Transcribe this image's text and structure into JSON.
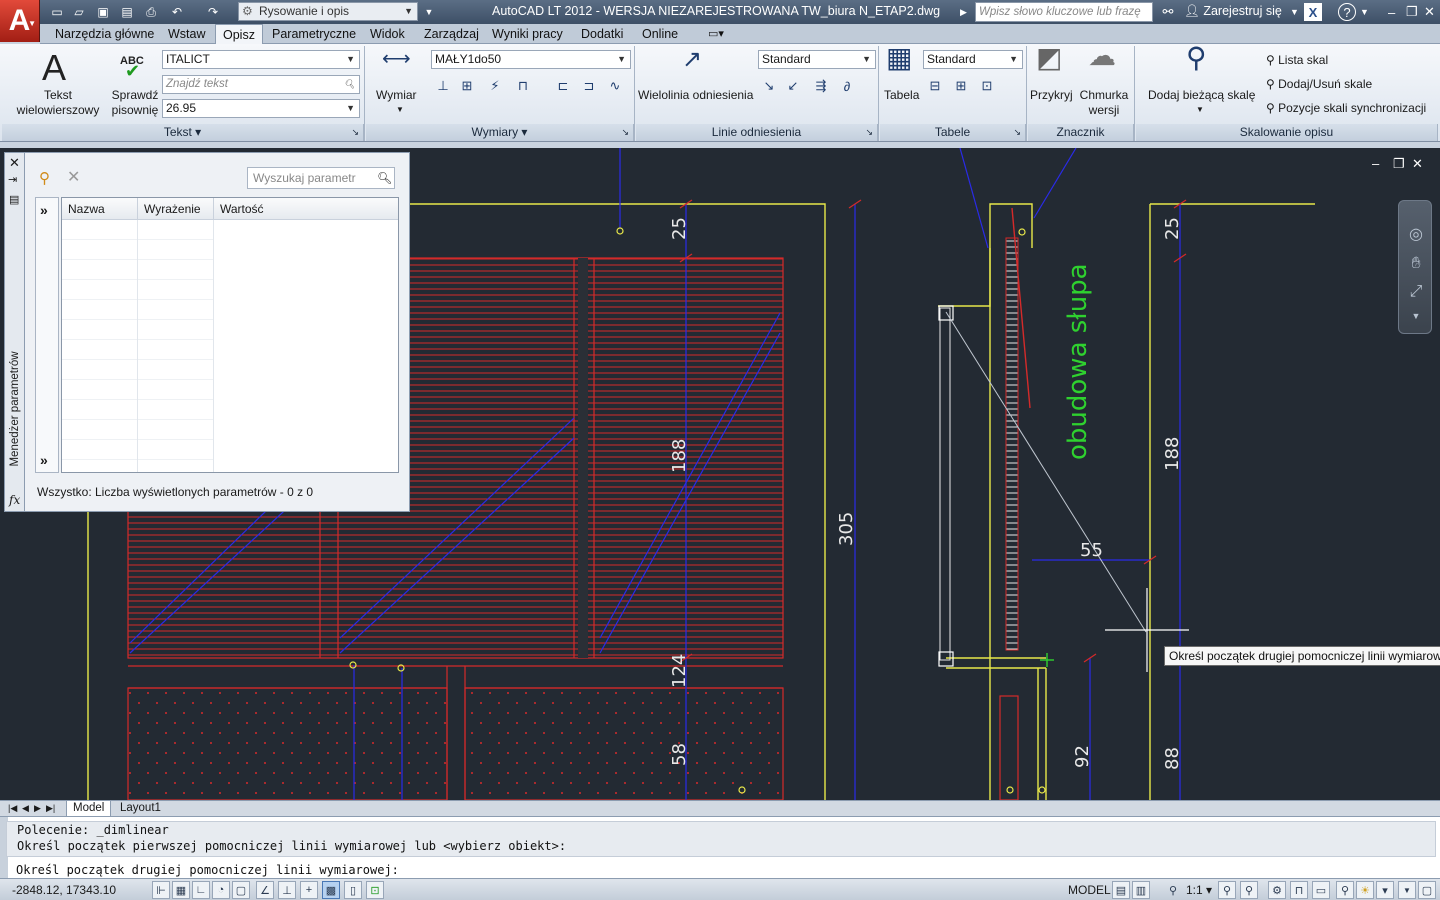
{
  "window": {
    "title": "AutoCAD LT 2012 - WERSJA NIEZAREJESTROWANA    TW_biura N_ETAP2.dwg",
    "workspace": "Rysowanie i opis",
    "search_placeholder": "Wpisz słowo kluczowe lub frazę",
    "sign_in": "Zarejestruj się"
  },
  "ribbon_tabs": [
    {
      "label": "Narzędzia główne"
    },
    {
      "label": "Wstaw"
    },
    {
      "label": "Opisz"
    },
    {
      "label": "Parametryczne"
    },
    {
      "label": "Widok"
    },
    {
      "label": "Zarządzaj"
    },
    {
      "label": "Wyniki pracy"
    },
    {
      "label": "Dodatki"
    },
    {
      "label": "Online"
    }
  ],
  "ribbon": {
    "tekst": {
      "panel_label": "Tekst",
      "multiline_line1": "Tekst",
      "multiline_line2": "wielowierszowy",
      "spell_line1": "Sprawdź",
      "spell_line2": "pisownię",
      "spell_abc": "ABC",
      "style": "ITALICT",
      "find_placeholder": "Znajdź tekst",
      "height": "26.95"
    },
    "wymiary": {
      "panel_label": "Wymiary",
      "dimension": "Wymiar",
      "style": "MAŁY1do50"
    },
    "linie": {
      "panel_label": "Linie odniesienia",
      "multileader": "Wielolinia odniesienia",
      "style": "Standard"
    },
    "tabele": {
      "panel_label": "Tabele",
      "table": "Tabela",
      "style": "Standard"
    },
    "znacznik": {
      "panel_label": "Znacznik",
      "wipeout": "Przykryj",
      "revcloud_line1": "Chmurka",
      "revcloud_line2": "wersji"
    },
    "skalowanie": {
      "panel_label": "Skalowanie opisu",
      "add_current_scale": "Dodaj bieżącą skalę",
      "scale_list": "Lista skal",
      "add_remove_scales": "Dodaj/Usuń skale",
      "sync_scale_positions": "Pozycje skali synchronizacji"
    }
  },
  "param_manager": {
    "side_title": "Menedżer parametrów",
    "search_placeholder": "Wyszukaj parametr",
    "columns": [
      "Nazwa",
      "Wyrażenie",
      "Wartość"
    ],
    "status": "Wszystko: Liczba wyświetlonych parametrów - 0 z 0",
    "fx": "fx"
  },
  "drawing": {
    "dimensions": [
      "25",
      "188",
      "124",
      "58",
      "305",
      "55",
      "25",
      "188",
      "92",
      "88"
    ],
    "label": "obudowa słupa"
  },
  "tooltip": "Określ początek drugiej pomocniczej linii wymiarowej:",
  "layout_tabs": [
    {
      "label": "Model"
    },
    {
      "label": "Layout1"
    }
  ],
  "command_line": {
    "history": [
      "Polecenie: _dimlinear",
      "Określ początek pierwszej pomocniczej linii wymiarowej lub <wybierz obiekt>:"
    ],
    "prompt": "Określ początek drugiej pomocniczej linii wymiarowej:"
  },
  "status_bar": {
    "coords": "-2848.12, 17343.10",
    "space": "MODEL",
    "scale": "1:1"
  },
  "colors": {
    "canvas": "#232a33",
    "red": "#e02a2a",
    "blue": "#2a2ae8",
    "yellow": "#e8e84a",
    "green": "#2fd12f"
  }
}
